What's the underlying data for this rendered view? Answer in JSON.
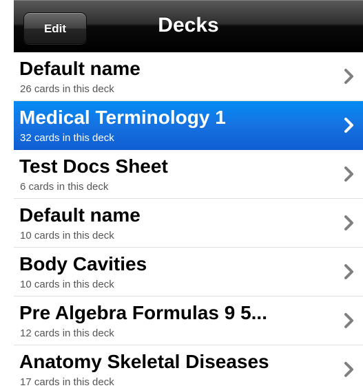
{
  "navbar": {
    "title": "Decks",
    "edit_label": "Edit"
  },
  "decks": [
    {
      "title": "Default name",
      "subtitle": "26 cards in this deck",
      "selected": false
    },
    {
      "title": "Medical Terminology 1",
      "subtitle": "32 cards in this deck",
      "selected": true
    },
    {
      "title": "Test Docs Sheet",
      "subtitle": "6 cards in this deck",
      "selected": false
    },
    {
      "title": "Default name",
      "subtitle": "10 cards in this deck",
      "selected": false
    },
    {
      "title": "Body Cavities",
      "subtitle": "10 cards in this deck",
      "selected": false
    },
    {
      "title": "Pre Algebra Formulas 9 5...",
      "subtitle": "12 cards in this deck",
      "selected": false
    },
    {
      "title": "Anatomy Skeletal Diseases",
      "subtitle": "17 cards in this deck",
      "selected": false
    }
  ],
  "icons": {
    "row_accessory": "chevron-right-icon"
  },
  "colors": {
    "selected_row": "#1672e0",
    "chevron": "#7f7f7f",
    "chevron_selected": "#ffffff"
  }
}
